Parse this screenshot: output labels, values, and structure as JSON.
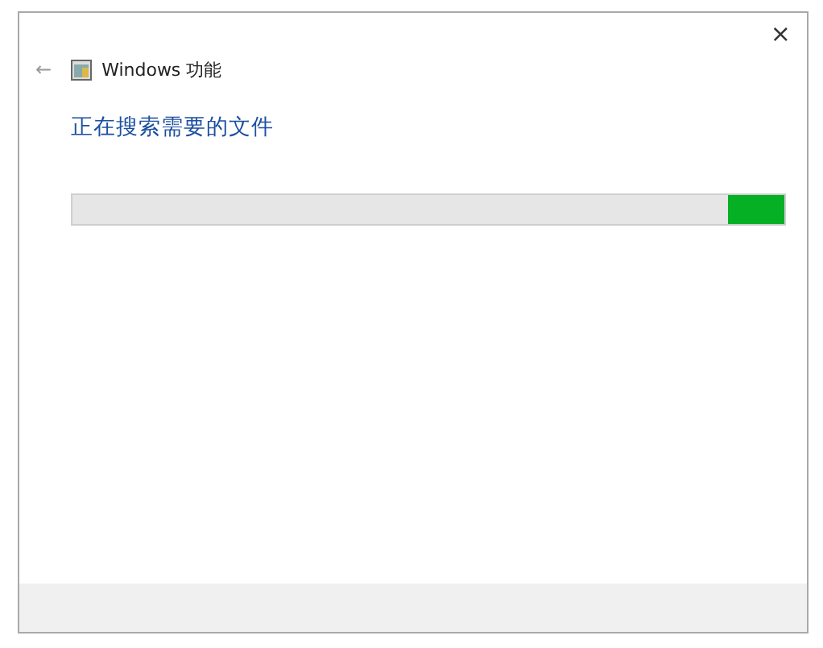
{
  "window": {
    "title": "Windows 功能",
    "close": "×",
    "back": "←"
  },
  "heading": "正在搜索需要的文件",
  "progress": {
    "indeterminate": true
  }
}
